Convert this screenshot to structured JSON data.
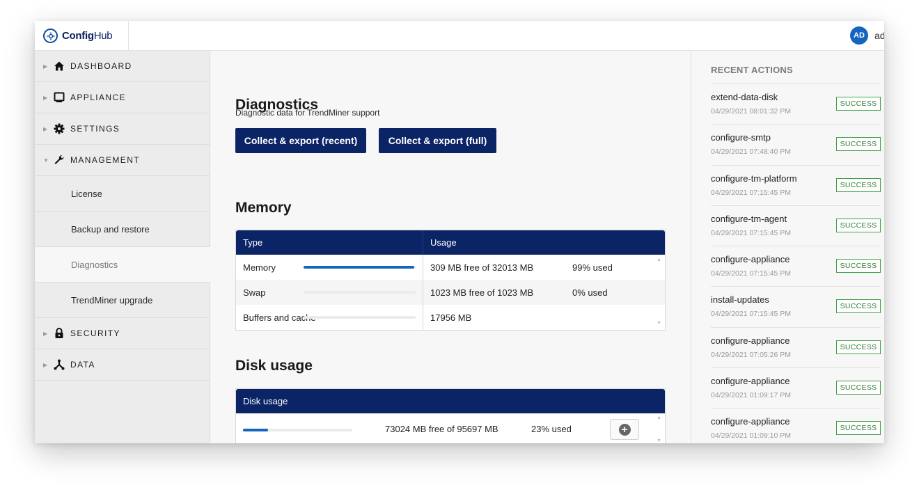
{
  "app": {
    "logo_text_bold": "Config",
    "logo_text_regular": "Hub",
    "user_initials": "AD",
    "user_name": "ad"
  },
  "sidebar": {
    "items": [
      {
        "label": "DASHBOARD",
        "icon": "home-icon",
        "expanded": false
      },
      {
        "label": "APPLIANCE",
        "icon": "monitor-icon",
        "expanded": false
      },
      {
        "label": "SETTINGS",
        "icon": "gear-icon",
        "expanded": false
      },
      {
        "label": "MANAGEMENT",
        "icon": "wrench-icon",
        "expanded": true
      },
      {
        "label": "SECURITY",
        "icon": "lock-icon",
        "expanded": false
      },
      {
        "label": "DATA",
        "icon": "network-icon",
        "expanded": false
      }
    ],
    "management_subitems": [
      {
        "label": "License"
      },
      {
        "label": "Backup and restore"
      },
      {
        "label": "Diagnostics",
        "active": true
      },
      {
        "label": "TrendMiner upgrade"
      }
    ]
  },
  "main": {
    "diagnostics": {
      "title": "Diagnostics",
      "description": "Diagnostic data for TrendMiner support",
      "btn_recent": "Collect & export (recent)",
      "btn_full": "Collect & export (full)"
    },
    "memory": {
      "title": "Memory",
      "columns": [
        "Type",
        "Usage"
      ],
      "rows": [
        {
          "type": "Memory",
          "usage": "309 MB free of 32013 MB",
          "percent": "99% used",
          "fraction": 0.99
        },
        {
          "type": "Swap",
          "usage": "1023 MB free of 1023 MB",
          "percent": "0% used",
          "fraction": 0.0
        },
        {
          "type": "Buffers and cache",
          "usage": "17956 MB",
          "percent": "",
          "fraction": 0.0
        }
      ]
    },
    "disk": {
      "title": "Disk usage",
      "header": "Disk usage",
      "rows": [
        {
          "usage": "73024 MB free of 95697 MB",
          "percent": "23% used",
          "fraction": 0.23
        }
      ]
    }
  },
  "recent_actions": {
    "title": "RECENT ACTIONS",
    "items": [
      {
        "name": "extend-data-disk",
        "time": "04/29/2021 08:01:32 PM",
        "status": "SUCCESS"
      },
      {
        "name": "configure-smtp",
        "time": "04/29/2021 07:48:40 PM",
        "status": "SUCCESS"
      },
      {
        "name": "configure-tm-platform",
        "time": "04/29/2021 07:15:45 PM",
        "status": "SUCCESS"
      },
      {
        "name": "configure-tm-agent",
        "time": "04/29/2021 07:15:45 PM",
        "status": "SUCCESS"
      },
      {
        "name": "configure-appliance",
        "time": "04/29/2021 07:15:45 PM",
        "status": "SUCCESS"
      },
      {
        "name": "install-updates",
        "time": "04/29/2021 07:15:45 PM",
        "status": "SUCCESS"
      },
      {
        "name": "configure-appliance",
        "time": "04/29/2021 07:05:26 PM",
        "status": "SUCCESS"
      },
      {
        "name": "configure-appliance",
        "time": "04/29/2021 01:09:17 PM",
        "status": "SUCCESS"
      },
      {
        "name": "configure-appliance",
        "time": "04/29/2021 01:09:10 PM",
        "status": "SUCCESS"
      }
    ]
  },
  "colors": {
    "primary_navy": "#0b2466",
    "accent_blue": "#1565c0",
    "success_green": "#2e7d32"
  }
}
